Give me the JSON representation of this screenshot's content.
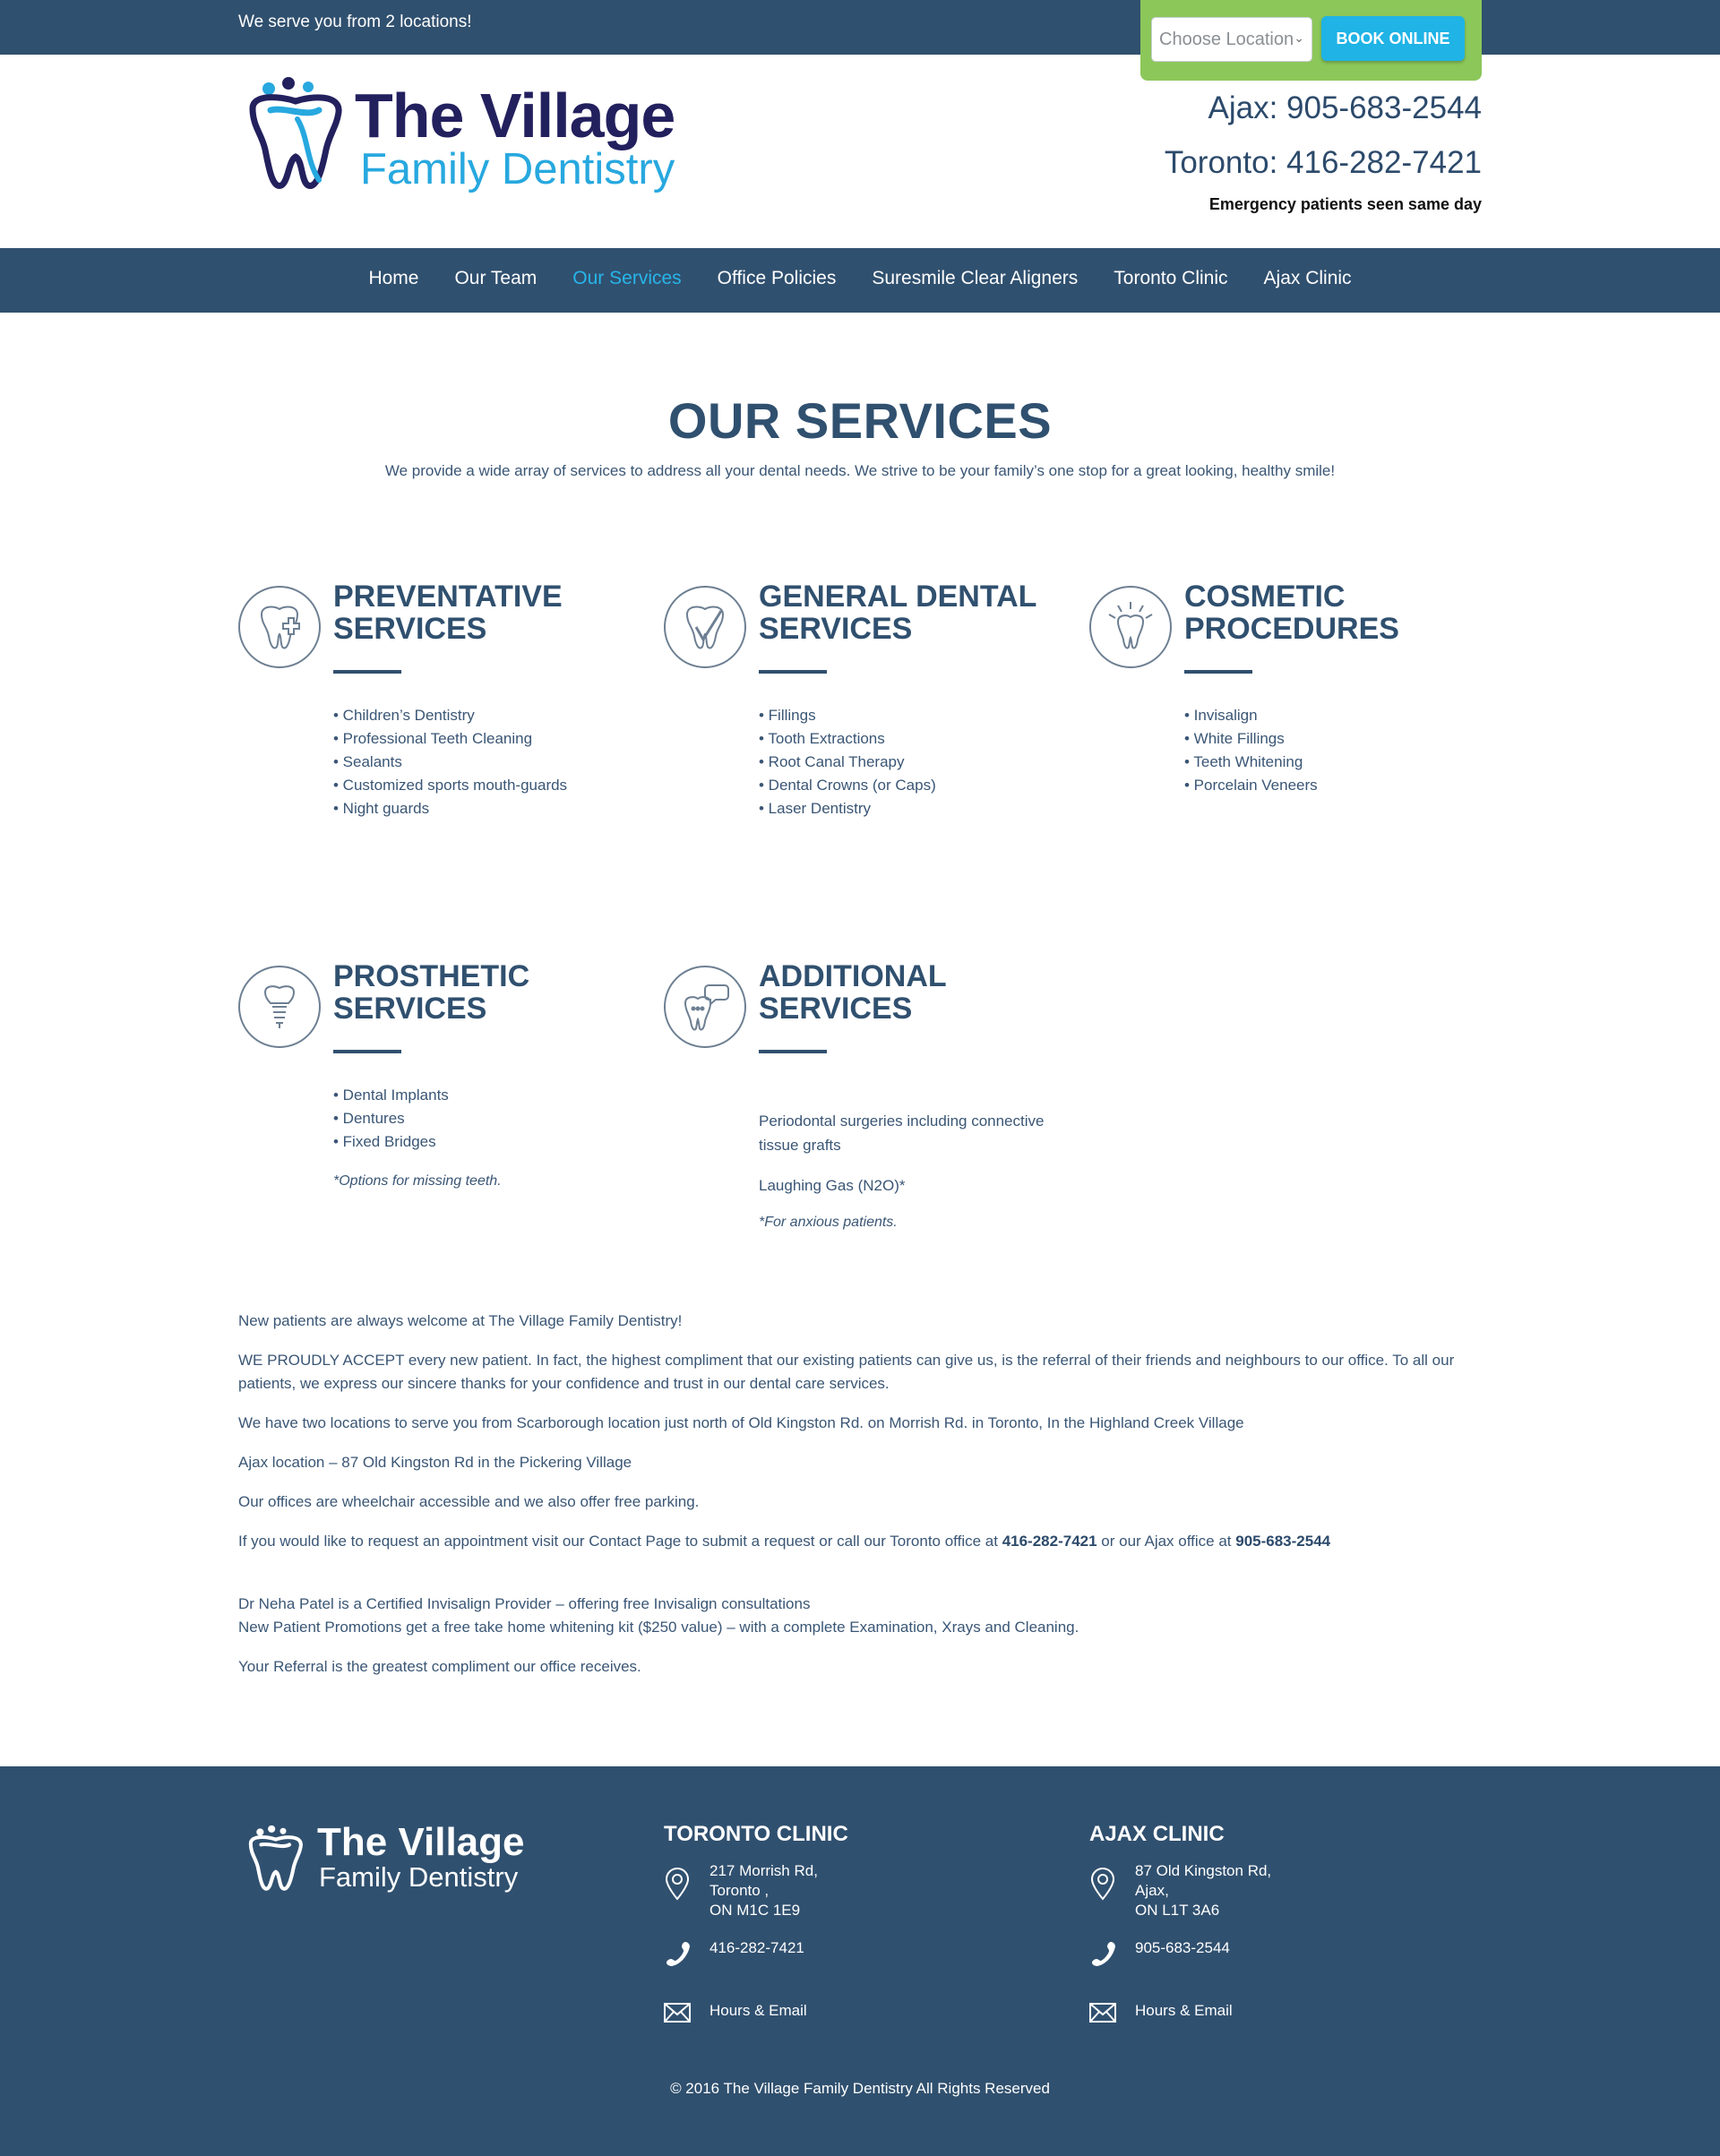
{
  "topbar": {
    "text": "We serve you from 2 locations!",
    "location_select": "Choose Location",
    "book_button": "BOOK ONLINE"
  },
  "header": {
    "logo_title": "The Village",
    "logo_subtitle": "Family Dentistry",
    "ajax_phone": "Ajax: 905-683-2544",
    "toronto_phone": "Toronto: 416-282-7421",
    "emergency": "Emergency patients seen same day"
  },
  "nav": {
    "items": [
      "Home",
      "Our Team",
      "Our Services",
      "Office Policies",
      "Suresmile Clear Aligners",
      "Toronto Clinic",
      "Ajax Clinic"
    ],
    "active": "Our Services"
  },
  "page": {
    "title": "OUR SERVICES",
    "intro": "We provide a wide array of services to address all your dental needs. We strive to be your family’s one stop for a great looking, healthy smile!"
  },
  "services": {
    "preventative": {
      "title_line1": "PREVENTATIVE",
      "title_line2": "SERVICES",
      "items": [
        "• Children’s Dentistry",
        "• Professional Teeth Cleaning",
        "• Sealants",
        "• Customized sports mouth-guards",
        "• Night guards"
      ]
    },
    "general": {
      "title_line1": "GENERAL DENTAL",
      "title_line2": "SERVICES",
      "items": [
        "• Fillings",
        "• Tooth Extractions",
        "• Root Canal Therapy",
        "• Dental Crowns (or Caps)",
        "• Laser Dentistry"
      ]
    },
    "cosmetic": {
      "title_line1": "COSMETIC",
      "title_line2": "PROCEDURES",
      "items": [
        "• Invisalign",
        "• White Fillings",
        "• Teeth Whitening",
        "• Porcelain Veneers"
      ]
    },
    "prosthetic": {
      "title_line1": "PROSTHETIC",
      "title_line2": "SERVICES",
      "items": [
        "• Dental Implants",
        "• Dentures",
        "• Fixed Bridges"
      ],
      "note": "*Options for missing teeth."
    },
    "additional": {
      "title_line1": "ADDITIONAL",
      "title_line2": "SERVICES",
      "para1": "Periodontal surgeries including connective tissue grafts",
      "para2": "Laughing Gas (N2O)*",
      "note": "*For anxious patients."
    }
  },
  "content": {
    "p1": "New patients are always welcome at The Village Family Dentistry!",
    "p2": "WE PROUDLY ACCEPT every new patient. In fact, the highest compliment that our existing patients can give us, is the referral of their friends and neighbours to our office. To all our patients, we express our sincere thanks for your confidence and trust in our dental care services.",
    "p3": "We have two locations to serve you from Scarborough location just north of Old Kingston Rd. on Morrish Rd. in Toronto, In the Highland Creek Village",
    "p4": "Ajax location – 87 Old Kingston Rd in the Pickering Village",
    "p5": "Our offices are wheelchair accessible and we also offer free parking.",
    "p6_a": "If you would like to request an appointment visit our Contact Page to submit a request or call our Toronto office at ",
    "p6_toronto": "416-282-7421",
    "p6_b": " or our Ajax office at ",
    "p6_ajax": "905-683-2544",
    "p7_line1": "Dr Neha Patel is a Certified Invisalign Provider – offering free Invisalign consultations",
    "p7_line2": "New Patient Promotions get a free take home whitening kit ($250 value) – with a complete Examination, Xrays and Cleaning.",
    "p8": "Your Referral is the greatest compliment our office receives."
  },
  "footer": {
    "logo_title": "The Village",
    "logo_subtitle": "Family Dentistry",
    "toronto": {
      "heading": "TORONTO CLINIC",
      "addr1": "217 Morrish Rd,",
      "addr2": "Toronto ,",
      "addr3": "ON M1C 1E9",
      "phone": "416-282-7421",
      "hours": "Hours & Email"
    },
    "ajax": {
      "heading": "AJAX CLINIC",
      "addr1": "87 Old Kingston Rd,",
      "addr2": "Ajax,",
      "addr3": "ON L1T 3A6",
      "phone": "905-683-2544",
      "hours": "Hours & Email"
    },
    "copyright": "© 2016 The Village Family Dentistry All Rights Reserved"
  },
  "colors": {
    "navy": "#30506f",
    "accent_blue": "#27b5ea",
    "book_green": "#8cc75a",
    "logo_dark": "#23205e"
  }
}
